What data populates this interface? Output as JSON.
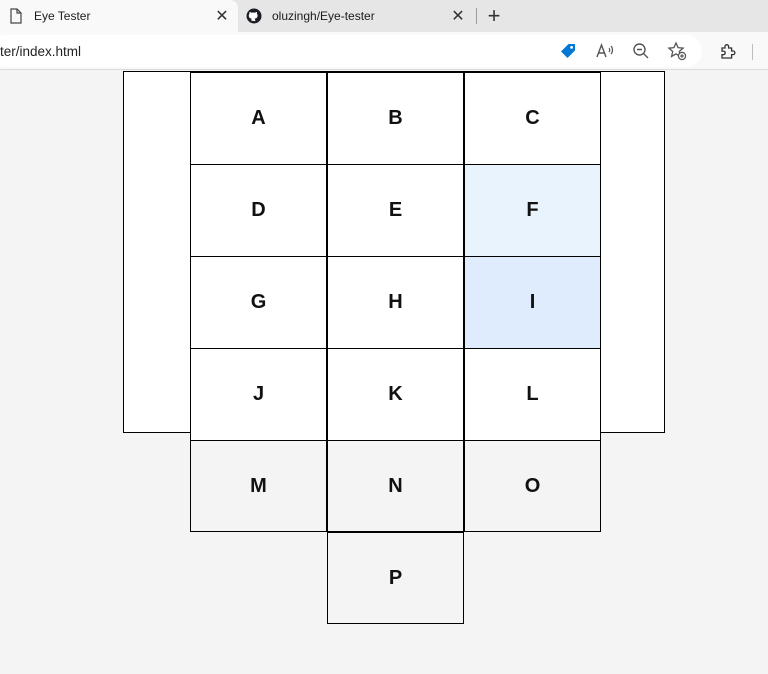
{
  "browser": {
    "tabs": [
      {
        "title": "Eye Tester",
        "icon": "page-icon",
        "active": true
      },
      {
        "title": "oluzingh/Eye-tester",
        "icon": "github-icon",
        "active": false
      }
    ],
    "close_glyph": "✕",
    "new_tab_glyph": "+",
    "address": "ter/index.html",
    "toolbar_icons": [
      "price-tag-icon",
      "read-aloud-icon",
      "zoom-out-icon",
      "favorites-add-icon",
      "extensions-icon"
    ],
    "accent_color": "#0078d4"
  },
  "grid": {
    "cells": [
      {
        "letter": "A",
        "highlight": "none"
      },
      {
        "letter": "B",
        "highlight": "none"
      },
      {
        "letter": "C",
        "highlight": "none"
      },
      {
        "letter": "D",
        "highlight": "none"
      },
      {
        "letter": "E",
        "highlight": "none"
      },
      {
        "letter": "F",
        "highlight": "light"
      },
      {
        "letter": "G",
        "highlight": "none"
      },
      {
        "letter": "H",
        "highlight": "none"
      },
      {
        "letter": "I",
        "highlight": "medium"
      },
      {
        "letter": "J",
        "highlight": "none"
      },
      {
        "letter": "K",
        "highlight": "none"
      },
      {
        "letter": "L",
        "highlight": "none"
      },
      {
        "letter": "M",
        "highlight": "none"
      },
      {
        "letter": "N",
        "highlight": "none"
      },
      {
        "letter": "O",
        "highlight": "none"
      },
      {
        "letter": "P",
        "highlight": "none"
      }
    ],
    "colors": {
      "inside": "#ffffff",
      "outside": "#f4f4f4",
      "light": "#e9f3fe",
      "medium": "#deecfd"
    }
  }
}
